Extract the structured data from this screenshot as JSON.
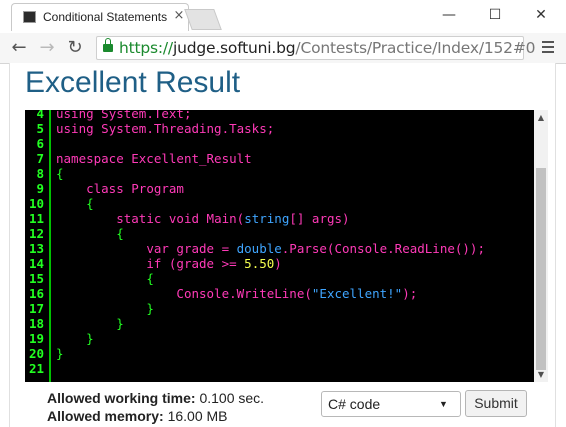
{
  "browser": {
    "tab_title": "Conditional Statements",
    "tab_close": "×",
    "window_minimize": "—",
    "window_maximize": "☐",
    "window_close": "✕",
    "back_icon": "←",
    "forward_icon": "→",
    "reload_icon": "↻",
    "url": {
      "scheme": "https://",
      "host": "judge.softuni.bg",
      "path": "/Contests/Practice/Index/152#0"
    }
  },
  "page": {
    "title": "Excellent Result"
  },
  "editor": {
    "line_numbers": [
      "4",
      "5",
      "6",
      "7",
      "8",
      "9",
      "10",
      "11",
      "12",
      "13",
      "14",
      "15",
      "16",
      "17",
      "18",
      "19",
      "20",
      "21"
    ],
    "lines": [
      [
        {
          "t": "using",
          "c": "#ff3ab8"
        },
        {
          "t": " System.Text;",
          "c": "#ff3ab8"
        }
      ],
      [
        {
          "t": "using",
          "c": "#ff3ab8"
        },
        {
          "t": " System.Threading.Tasks;",
          "c": "#ff3ab8"
        }
      ],
      [],
      [
        {
          "t": "namespace",
          "c": "#ff3ab8"
        },
        {
          "t": " Excellent_Result",
          "c": "#ff3ab8"
        }
      ],
      [
        {
          "t": "{",
          "c": "#22ff22"
        }
      ],
      [
        {
          "t": "    "
        },
        {
          "t": "class",
          "c": "#ff3ab8"
        },
        {
          "t": " Program",
          "c": "#ff3ab8"
        }
      ],
      [
        {
          "t": "    "
        },
        {
          "t": "{",
          "c": "#22ff22"
        }
      ],
      [
        {
          "t": "        "
        },
        {
          "t": "static void",
          "c": "#ff3ab8"
        },
        {
          "t": " Main",
          "c": "#ff3ab8"
        },
        {
          "t": "(",
          "c": "#ff3ab8"
        },
        {
          "t": "string",
          "c": "#3fa5ff"
        },
        {
          "t": "[] args)",
          "c": "#ff3ab8"
        }
      ],
      [
        {
          "t": "        "
        },
        {
          "t": "{",
          "c": "#22ff22"
        }
      ],
      [
        {
          "t": "            "
        },
        {
          "t": "var",
          "c": "#ff3ab8"
        },
        {
          "t": " grade = ",
          "c": "#ff3ab8"
        },
        {
          "t": "double",
          "c": "#3fa5ff"
        },
        {
          "t": ".Parse(Console.ReadLine());",
          "c": "#ff3ab8"
        }
      ],
      [
        {
          "t": "            "
        },
        {
          "t": "if",
          "c": "#ff3ab8"
        },
        {
          "t": " (grade >= ",
          "c": "#ff3ab8"
        },
        {
          "t": "5.50",
          "c": "#f5ff4f"
        },
        {
          "t": ")",
          "c": "#ff3ab8"
        }
      ],
      [
        {
          "t": "            "
        },
        {
          "t": "{",
          "c": "#22ff22"
        }
      ],
      [
        {
          "t": "                "
        },
        {
          "t": "Console.WriteLine(",
          "c": "#ff3ab8"
        },
        {
          "t": "\"Excellent!\"",
          "c": "#3fa5ff"
        },
        {
          "t": ");",
          "c": "#ff3ab8"
        }
      ],
      [
        {
          "t": "            "
        },
        {
          "t": "}",
          "c": "#22ff22"
        }
      ],
      [
        {
          "t": "        "
        },
        {
          "t": "}",
          "c": "#22ff22"
        }
      ],
      [
        {
          "t": "    "
        },
        {
          "t": "}",
          "c": "#22ff22"
        }
      ],
      [
        {
          "t": "}",
          "c": "#22ff22"
        }
      ],
      []
    ]
  },
  "limits": {
    "time_label": "Allowed working time:",
    "time_value": "0.100 sec.",
    "memory_label": "Allowed memory:",
    "memory_value": "16.00 MB"
  },
  "form": {
    "language_selected": "C# code",
    "submit_label": "Submit"
  },
  "colors": {
    "page_title": "#1f5f86",
    "editor_bg": "#000000",
    "line_number": "#22ff22",
    "keyword_pink": "#ff3ab8",
    "type_blue": "#3fa5ff",
    "number_yellow": "#f5ff4f",
    "https_green": "#1b8a2e"
  }
}
